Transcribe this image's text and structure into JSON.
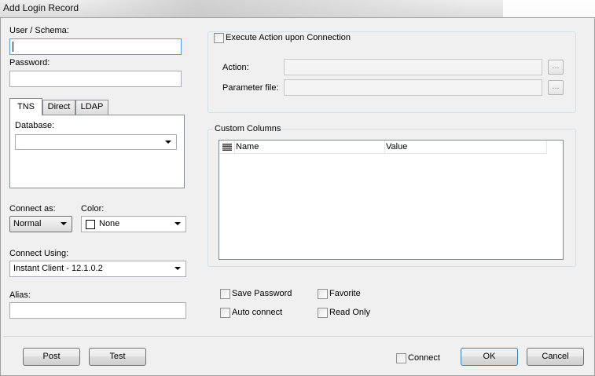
{
  "window": {
    "title": "Add Login Record"
  },
  "login": {
    "user_label": "User / Schema:",
    "user_value": "",
    "password_label": "Password:",
    "password_value": ""
  },
  "tabs": [
    {
      "label": "TNS",
      "active": true
    },
    {
      "label": "Direct",
      "active": false
    },
    {
      "label": "LDAP",
      "active": false
    }
  ],
  "tns": {
    "database_label": "Database:",
    "database_value": ""
  },
  "connect_as": {
    "label": "Connect as:",
    "value": "Normal"
  },
  "color": {
    "label": "Color:",
    "value": "None",
    "swatch": "#ffffff"
  },
  "connect_using": {
    "label": "Connect Using:",
    "value": "Instant Client - 12.1.0.2"
  },
  "alias": {
    "label": "Alias:",
    "value": ""
  },
  "execute": {
    "checkbox_label": "Execute Action upon Connection",
    "action_label": "Action:",
    "parameter_label": "Parameter file:",
    "browse_label": "..."
  },
  "custom_columns": {
    "title": "Custom Columns",
    "columns": [
      "Name",
      "Value"
    ],
    "rows": []
  },
  "options": {
    "save_password": "Save Password",
    "favorite": "Favorite",
    "auto_connect": "Auto connect",
    "read_only": "Read Only"
  },
  "footer": {
    "post": "Post",
    "test": "Test",
    "connect": "Connect",
    "ok": "OK",
    "cancel": "Cancel"
  },
  "colors": {
    "focus_border": "#569de5",
    "default_button_border": "#3c7fb1"
  }
}
